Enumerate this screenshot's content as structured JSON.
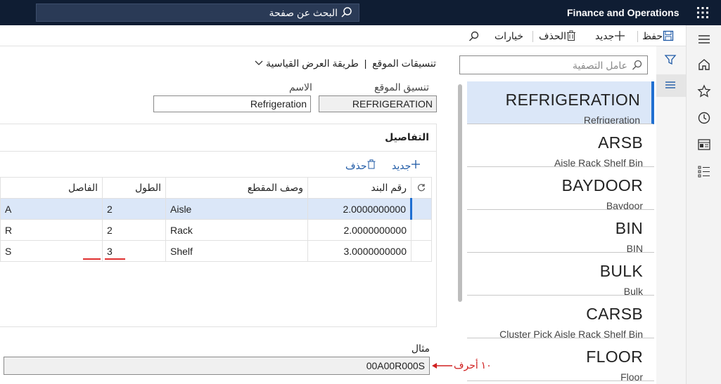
{
  "topbar": {
    "search_text": "البحث عن صفحة",
    "brand": "Finance and Operations"
  },
  "actionbar": {
    "save": "حفظ",
    "new": "جديد",
    "delete": "الحذف",
    "options": "خيارات"
  },
  "list": {
    "filter_placeholder": "عامل التصفية",
    "items": [
      {
        "name": "REFRIGERATION",
        "desc": "Refrigeration",
        "selected": true
      },
      {
        "name": "ARSB",
        "desc": "Aisle Rack Shelf Bin"
      },
      {
        "name": "BAYDOOR",
        "desc": "Baydoor"
      },
      {
        "name": "BIN",
        "desc": "BIN"
      },
      {
        "name": "BULK",
        "desc": "Bulk"
      },
      {
        "name": "CARSB",
        "desc": "Cluster Pick Aisle Rack Shelf Bin"
      },
      {
        "name": "FLOOR",
        "desc": "Floor"
      }
    ]
  },
  "form": {
    "crumb_main": "تنسيقات الموقع",
    "crumb_sep": "|",
    "crumb_view": "طريقة العرض القياسية",
    "format_label": "تنسيق الموقع",
    "format_value": "REFRIGERATION",
    "name_label": "الاسم",
    "name_value": "Refrigeration",
    "details_title": "التفاصيل",
    "details_new": "جديد",
    "details_delete": "حذف",
    "grid_headers": {
      "line": "رقم البند",
      "desc": "وصف المقطع",
      "length": "الطول",
      "sep": "الفاصل"
    },
    "rows": [
      {
        "line": "2.0000000000",
        "desc": "Aisle",
        "length": "2",
        "sep": "A"
      },
      {
        "line": "2.0000000000",
        "desc": "Rack",
        "length": "2",
        "sep": "R"
      },
      {
        "line": "3.0000000000",
        "desc": "Shelf",
        "length": "3",
        "sep": "S"
      }
    ],
    "example_label": "مثال",
    "example_value": "00A00R000S",
    "annotation": "١٠ أحرف"
  },
  "colors": {
    "topbar": "#0f1d33",
    "accent": "#1f6fd1",
    "selected": "#dbe7f8",
    "annotation": "#d02020"
  }
}
